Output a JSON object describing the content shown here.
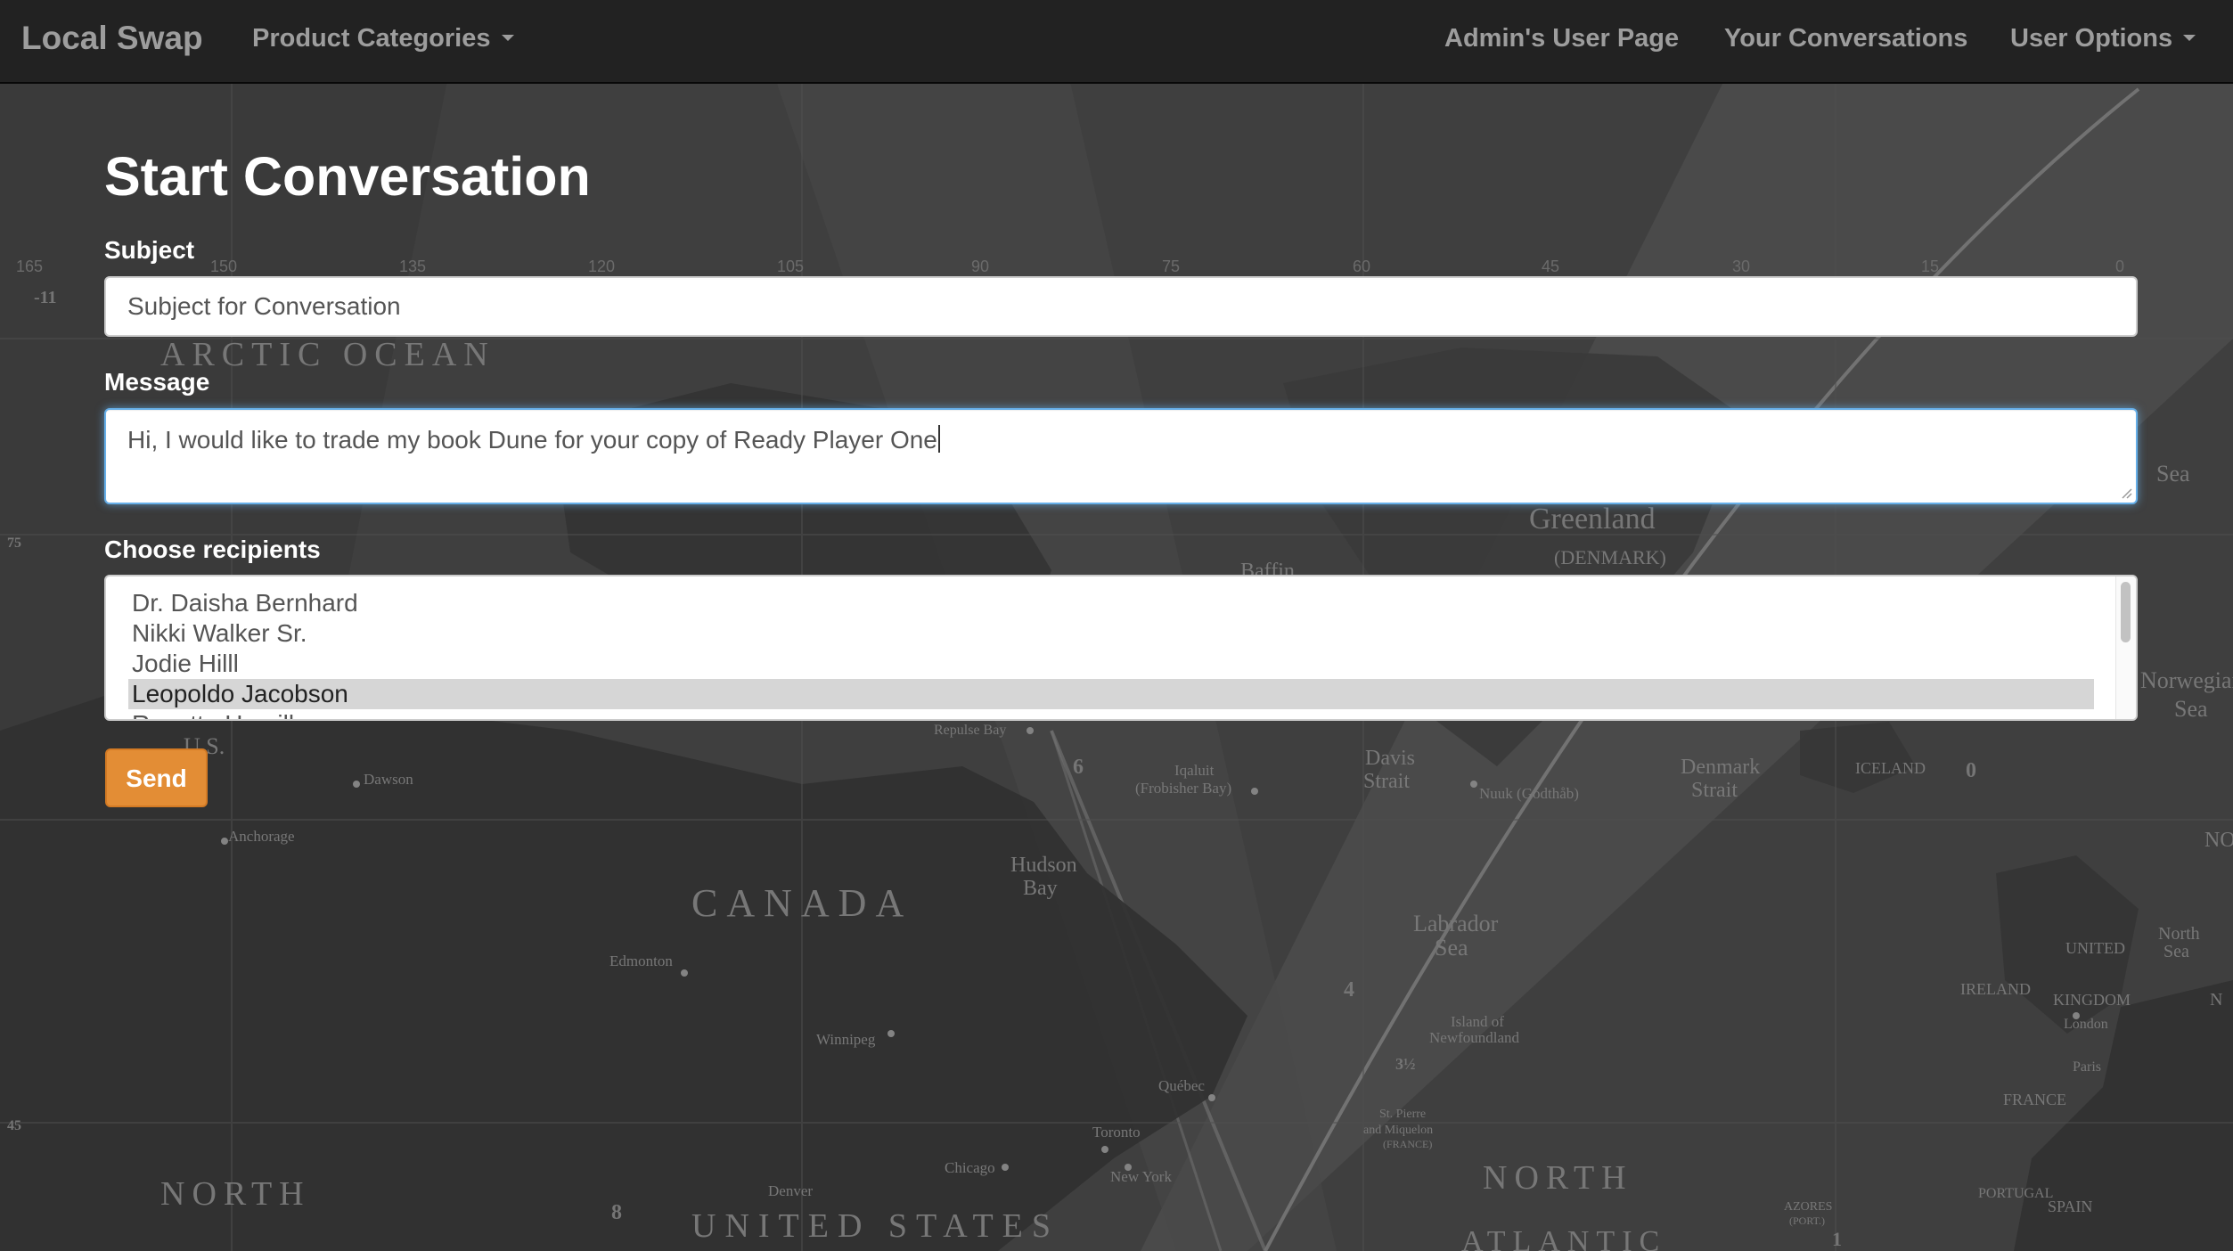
{
  "navbar": {
    "brand": "Local Swap",
    "product_categories": "Product Categories",
    "admin_page": "Admin's User Page",
    "conversations": "Your Conversations",
    "user_options": "User Options"
  },
  "page": {
    "title": "Start Conversation"
  },
  "form": {
    "subject_label": "Subject",
    "subject_value": "Subject for Conversation",
    "message_label": "Message",
    "message_value": "Hi, I would like to trade my book Dune for your copy of Ready Player One",
    "recipients_label": "Choose recipients",
    "recipients": [
      {
        "name": "Dr. Daisha Bernhard",
        "selected": false
      },
      {
        "name": "Nikki Walker Sr.",
        "selected": false
      },
      {
        "name": "Jodie Hilll",
        "selected": false
      },
      {
        "name": "Leopoldo Jacobson",
        "selected": true
      },
      {
        "name": "Rosetta Hamill",
        "selected": false
      }
    ],
    "send_label": "Send"
  },
  "background_map": {
    "labels": [
      "ARCTIC OCEAN",
      "Greenland",
      "(DENMARK)",
      "Baffin",
      "CANADA",
      "Hudson",
      "Bay",
      "Davis",
      "Strait",
      "Denmark",
      "Strait",
      "ICELAND",
      "Labrador",
      "Sea",
      "Norwegian",
      "Sea",
      "NORTH",
      "UNITED STATES",
      "NORTH",
      "ATLANTIC",
      "UNITED",
      "KINGDOM",
      "IRELAND",
      "FRANCE",
      "SPAIN",
      "PORTUGAL",
      "North",
      "Sea",
      "Edmonton",
      "Winnipeg",
      "Anchorage",
      "Dawson",
      "Chicago",
      "New York",
      "Toronto",
      "Québec",
      "Denver",
      "Iqaluit",
      "(Frobisher Bay)",
      "Nuuk (Godthåb)",
      "Island of",
      "Newfoundland",
      "St. Pierre",
      "and Miquelon",
      "(FRANCE)",
      "London",
      "Paris",
      "AZORES",
      "(PORT.)",
      "Repulse Bay",
      "U.S.",
      "Sea",
      "NOR",
      "N"
    ],
    "ticks": [
      "165",
      "150",
      "135",
      "120",
      "105",
      "90",
      "75",
      "60",
      "45",
      "30",
      "15",
      "0"
    ],
    "markers": [
      "-11",
      "75",
      "45",
      "6",
      "4",
      "8",
      "3½",
      "0",
      "1"
    ]
  },
  "colors": {
    "navbar_bg": "#222222",
    "navbar_text": "#9d9d9d",
    "send_button": "#e38d35",
    "focus_glow": "#66afe9",
    "selected_option": "#d6d6d6"
  }
}
